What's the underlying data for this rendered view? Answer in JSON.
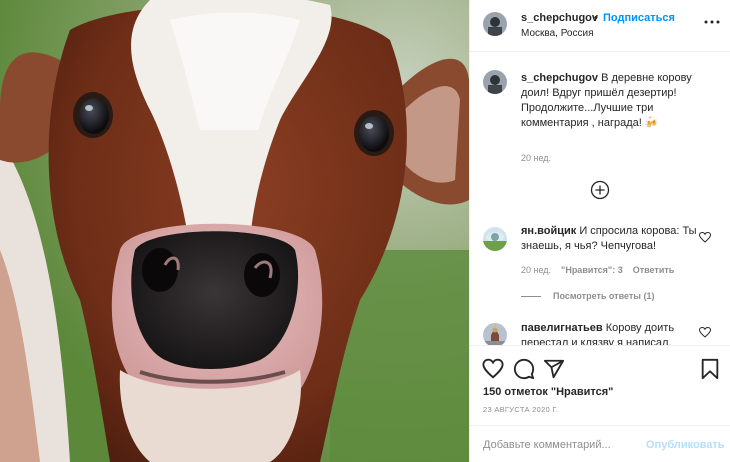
{
  "header": {
    "username": "s_chepchugov",
    "separator": "•",
    "follow_label": "Подписаться",
    "location": "Москва, Россия"
  },
  "caption": {
    "username": "s_chepchugov",
    "text": "В деревне корову доил! Вдруг пришёл дезертир! Продолжите...Лучшие три комментария , награда! 🍻",
    "time": "20 нед."
  },
  "comments": [
    {
      "username": "ян.войцик",
      "text": "И спросила корова: Ты знаешь, я чья? Чепчугова!",
      "time": "20 нед.",
      "likes": "\"Нравится\": 3",
      "reply": "Ответить",
      "view_replies": "Посмотреть ответы (1)"
    },
    {
      "username": "павелигнатьев",
      "text": "Корову доить перестал и клязву я написал."
    }
  ],
  "actions": {
    "likes": "150 отметок \"Нравится\"",
    "date": "23 АВГУСТА 2020 Г."
  },
  "add_comment": {
    "placeholder": "Добавьте комментарий...",
    "publish": "Опубликовать"
  },
  "colors": {
    "accent": "#0095f6",
    "publish_disabled": "#b2dffc",
    "secondary_text": "#8e8e8e",
    "divider": "#efefef"
  },
  "icons": [
    "more-icon",
    "add-comment-icon",
    "heart-icon",
    "comment-icon",
    "share-icon",
    "bookmark-icon"
  ]
}
